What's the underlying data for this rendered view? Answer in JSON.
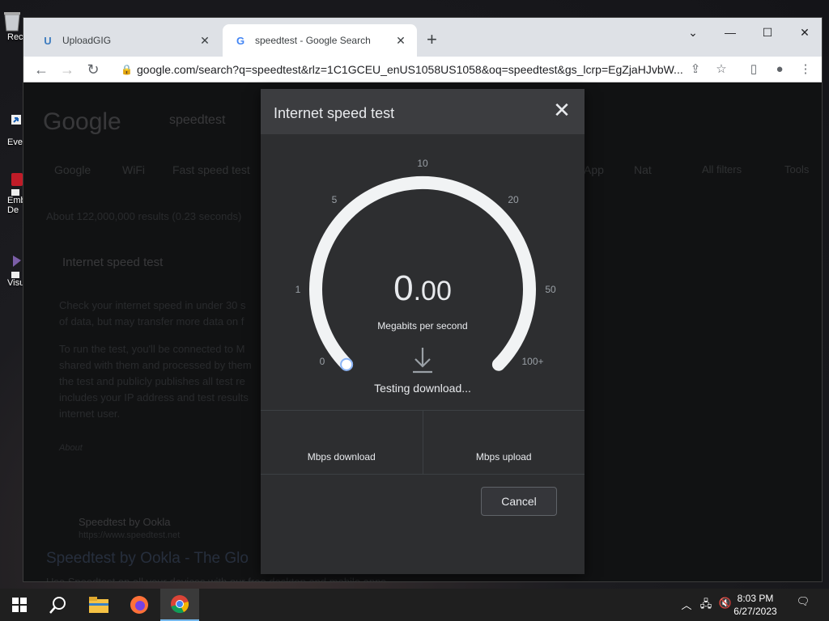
{
  "desktop": {
    "icons": [
      {
        "label": "Rec"
      },
      {
        "label": "Eve"
      },
      {
        "label": "Emb"
      },
      {
        "label": "De"
      },
      {
        "label": "Visu"
      }
    ]
  },
  "browser": {
    "tabs": [
      {
        "label": "UploadGIG",
        "favicon": "U"
      },
      {
        "label": "speedtest - Google Search",
        "favicon": "G"
      }
    ],
    "new_tab": "+",
    "address": "google.com/search?q=speedtest&rlz=1C1GCEU_enUS1058US1058&oq=speedtest&gs_lcrp=EgZjaHJvbW..."
  },
  "page": {
    "logo": "Google",
    "query": "speedtest",
    "filters": [
      "Google",
      "WiFi",
      "Fast speed test",
      "App",
      "Nat",
      "All filters",
      "Tools"
    ],
    "stats": "About 122,000,000 results (0.23 seconds)",
    "section_title": "Internet speed test",
    "para1": [
      "Check your internet speed in under 30 s",
      "of data, but may transfer more data on f"
    ],
    "para2": [
      "To run the test, you'll be connected to M",
      "shared with them and processed by them",
      "the test and publicly publishes all test re",
      "includes your IP address and test results",
      "internet user."
    ],
    "about": "About",
    "ookla_name": "Speedtest by Ookla",
    "ookla_url": "https://www.speedtest.net",
    "ookla_link": "Speedtest by Ookla - The Glo",
    "ookla_desc": "Use Speedtest on all your devices with our free desktop and mobile apps."
  },
  "modal": {
    "title": "Internet speed test",
    "close": "✕",
    "ticks": [
      "0",
      "1",
      "5",
      "10",
      "20",
      "50",
      "100+"
    ],
    "speed_int": "0",
    "speed_dec": ".00",
    "unit": "Megabits per second",
    "status": "Testing download...",
    "download_label": "Mbps download",
    "upload_label": "Mbps upload",
    "cancel": "Cancel"
  },
  "taskbar": {
    "time": "8:03 PM",
    "date": "6/27/2023"
  }
}
